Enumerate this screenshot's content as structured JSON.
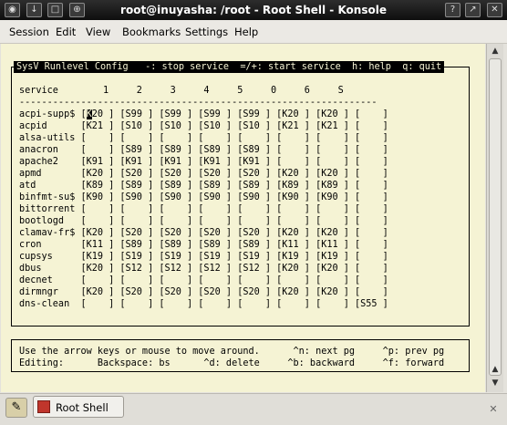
{
  "window": {
    "title": "root@inuyasha: /root - Root Shell - Konsole"
  },
  "menubar": {
    "items": [
      "Session",
      "Edit",
      "View",
      "Bookmarks",
      "Settings",
      "Help"
    ]
  },
  "terminal": {
    "header": "SysV Runlevel Config   -: stop service  =/+: start service  h: help  q: quit",
    "columns": "service        1     2     3     4     5     0     6     S",
    "separator": "----------------------------------------------------------------",
    "cursor_char": "K",
    "rows": [
      "acpi-supp$ [K20 ] [S99 ] [S99 ] [S99 ] [S99 ] [K20 ] [K20 ] [    ]",
      "acpid      [K21 ] [S10 ] [S10 ] [S10 ] [S10 ] [K21 ] [K21 ] [    ]",
      "alsa-utils [    ] [    ] [    ] [    ] [    ] [    ] [    ] [    ]",
      "anacron    [    ] [S89 ] [S89 ] [S89 ] [S89 ] [    ] [    ] [    ]",
      "apache2    [K91 ] [K91 ] [K91 ] [K91 ] [K91 ] [    ] [    ] [    ]",
      "apmd       [K20 ] [S20 ] [S20 ] [S20 ] [S20 ] [K20 ] [K20 ] [    ]",
      "atd        [K89 ] [S89 ] [S89 ] [S89 ] [S89 ] [K89 ] [K89 ] [    ]",
      "binfmt-su$ [K90 ] [S90 ] [S90 ] [S90 ] [S90 ] [K90 ] [K90 ] [    ]",
      "bittorrent [    ] [    ] [    ] [    ] [    ] [    ] [    ] [    ]",
      "bootlogd   [    ] [    ] [    ] [    ] [    ] [    ] [    ] [    ]",
      "clamav-fr$ [K20 ] [S20 ] [S20 ] [S20 ] [S20 ] [K20 ] [K20 ] [    ]",
      "cron       [K11 ] [S89 ] [S89 ] [S89 ] [S89 ] [K11 ] [K11 ] [    ]",
      "cupsys     [K19 ] [S19 ] [S19 ] [S19 ] [S19 ] [K19 ] [K19 ] [    ]",
      "dbus       [K20 ] [S12 ] [S12 ] [S12 ] [S12 ] [K20 ] [K20 ] [    ]",
      "decnet     [    ] [    ] [    ] [    ] [    ] [    ] [    ] [    ]",
      "dirmngr    [K20 ] [S20 ] [S20 ] [S20 ] [S20 ] [K20 ] [K20 ] [    ]",
      "dns-clean  [    ] [    ] [    ] [    ] [    ] [    ] [    ] [S55 ]"
    ],
    "help1": "Use the arrow keys or mouse to move around.      ^n: next pg     ^p: prev pg",
    "help2": "Editing:      Backspace: bs      ^d: delete     ^b: backward     ^f: forward"
  },
  "taskbar": {
    "tab_label": "Root Shell"
  },
  "colors": {
    "terminal_bg": "#f5f3d4",
    "titlebar": "#1a1a1a"
  }
}
